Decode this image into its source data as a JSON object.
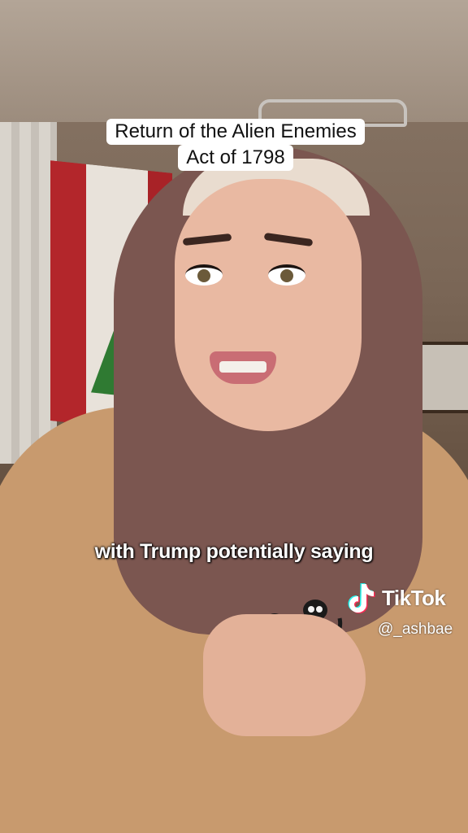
{
  "caption": {
    "line1": "Return of the Alien Enemies",
    "line2": "Act of 1798"
  },
  "subtitle": "with Trump potentially saying",
  "watermark": {
    "brand": "TikTok",
    "handle": "@_ashbae",
    "icon": "tiktok-logo-icon"
  },
  "colors": {
    "caption_bg": "#ffffff",
    "subtitle_text": "#ffffff"
  }
}
